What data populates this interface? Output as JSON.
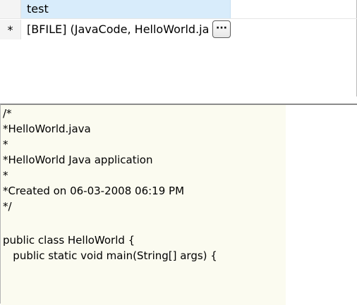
{
  "grid": {
    "column_header": "test",
    "row_indicator": "*",
    "cell_value": "[BFILE] (JavaCode, HelloWorld.java)",
    "ellipsis_label": "···"
  },
  "editor": {
    "lines": [
      "/*",
      "*HelloWorld.java",
      "*",
      "*HelloWorld Java application",
      "*",
      "*Created on 06-03-2008 06:19 PM",
      "*/",
      "",
      "public class HelloWorld {",
      "   public static void main(String[] args) {"
    ]
  }
}
